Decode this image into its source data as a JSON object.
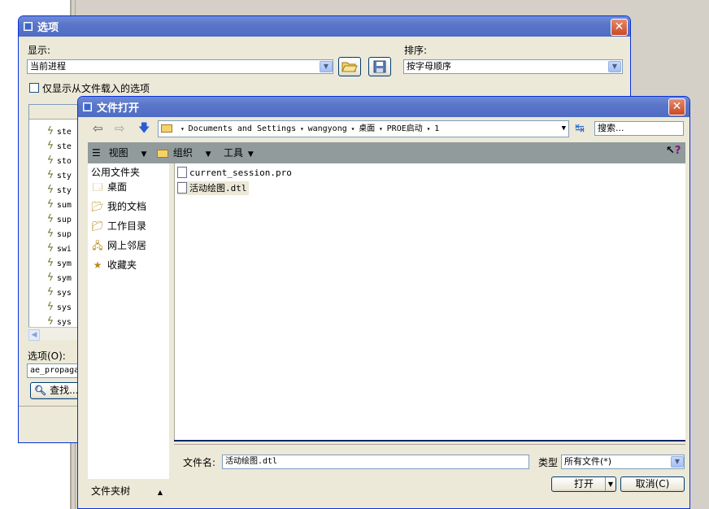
{
  "options_window": {
    "title": "选项",
    "close_glyph": "✕",
    "show_label": "显示:",
    "show_value": "当前进程",
    "sort_label": "排序:",
    "sort_value": "按字母顺序",
    "only_loaded_label": "仅显示从文件载入的选项",
    "tree_items": [
      "ste",
      "ste",
      "sto",
      "sty",
      "sty",
      "sum",
      "sup",
      "sup",
      "swi",
      "sym",
      "sym",
      "sys",
      "sys",
      "sys"
    ],
    "option_label": "选项(O):",
    "option_value": "ae_propaga",
    "find_button": "查找..."
  },
  "file_dialog": {
    "title": "文件打开",
    "close_glyph": "✕",
    "breadcrumb": [
      "Documents and Settings",
      "wangyong",
      "桌面",
      "PROE启动",
      "1"
    ],
    "search_placeholder": "搜索...",
    "toolbar": {
      "view_label": "视图",
      "organize_label": "组织",
      "tools_label": "工具"
    },
    "places_header": "公用文件夹",
    "places": [
      {
        "label": "桌面",
        "icon": "desktop-icon"
      },
      {
        "label": "我的文档",
        "icon": "documents-icon"
      },
      {
        "label": "工作目录",
        "icon": "working-dir-icon"
      },
      {
        "label": "网上邻居",
        "icon": "network-icon"
      },
      {
        "label": "收藏夹",
        "icon": "favorites-icon"
      }
    ],
    "files": [
      "current_session.pro",
      "活动绘图.dtl"
    ],
    "filename_label": "文件名:",
    "filename_value": "活动绘图.dtl",
    "type_label": "类型",
    "type_value": "所有文件(*)",
    "open_button": "打开",
    "cancel_button": "取消(C)",
    "folder_tree_label": "文件夹树"
  },
  "colors": {
    "titlebar": "#5a76c9",
    "window_bg": "#ece9d8",
    "toolbar_strip": "#919b9c"
  }
}
